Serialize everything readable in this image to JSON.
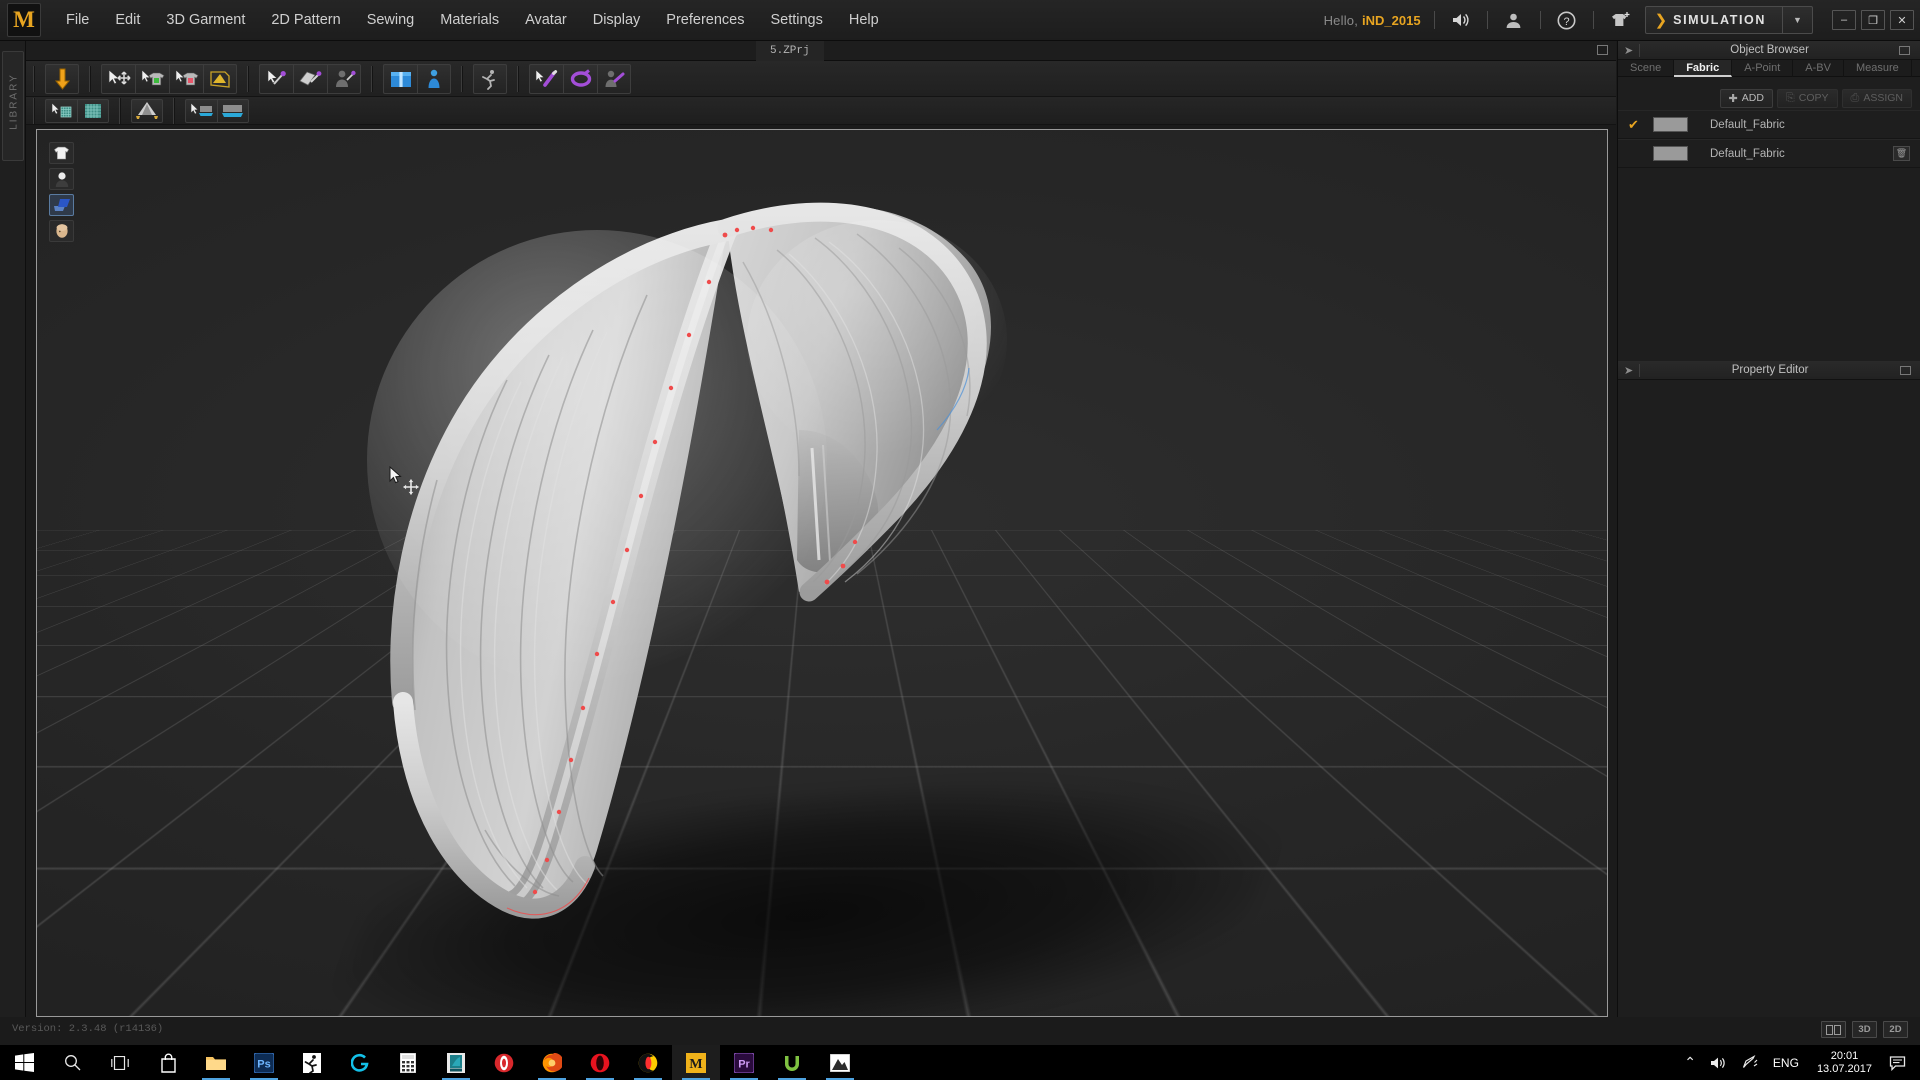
{
  "app": {
    "logo_letter": "M",
    "menu_items": [
      "File",
      "Edit",
      "3D Garment",
      "2D Pattern",
      "Sewing",
      "Materials",
      "Avatar",
      "Display",
      "Preferences",
      "Settings",
      "Help"
    ],
    "greeting": "Hello,",
    "username": "iND_2015",
    "mode_label": "SIMULATION",
    "library_rail_label": "LIBRARY",
    "file_tab": "5.ZPrj",
    "version_text": "Version: 2.3.48    (r14136)"
  },
  "titlebar_icons": [
    {
      "name": "speaker-icon",
      "glyph": "🔊"
    },
    {
      "name": "user-account-icon",
      "glyph": "👤"
    },
    {
      "name": "help-icon",
      "glyph": "?"
    },
    {
      "name": "add-garment-icon",
      "glyph": "👕"
    }
  ],
  "window_controls": [
    {
      "name": "minimize-button",
      "glyph": "–"
    },
    {
      "name": "restore-button",
      "glyph": "❐"
    },
    {
      "name": "close-button",
      "glyph": "✕"
    }
  ],
  "toolbar_row1": [
    {
      "group": "sync",
      "buttons": [
        {
          "name": "simulate-button",
          "icon": "down-arrow-orange"
        }
      ]
    },
    {
      "group": "transform",
      "buttons": [
        {
          "name": "select-move-button",
          "icon": "cursor-move"
        },
        {
          "name": "select-mesh-green-button",
          "icon": "shirt-green"
        },
        {
          "name": "select-mesh-red-button",
          "icon": "shirt-red"
        },
        {
          "name": "fold-arrangement-button",
          "icon": "fold-plane"
        }
      ]
    },
    {
      "group": "pin",
      "buttons": [
        {
          "name": "pin-button",
          "icon": "pin"
        },
        {
          "name": "fold-pin-button",
          "icon": "plane-pin"
        },
        {
          "name": "avatar-pin-button",
          "icon": "avatar-pin"
        }
      ]
    },
    {
      "group": "arrange",
      "buttons": [
        {
          "name": "arrangement-points-button",
          "icon": "box-blue"
        },
        {
          "name": "avatar-arrange-button",
          "icon": "avatar-blue"
        }
      ]
    },
    {
      "group": "animation",
      "buttons": [
        {
          "name": "animation-button",
          "icon": "runner"
        }
      ]
    },
    {
      "group": "tack",
      "buttons": [
        {
          "name": "select-tack-button",
          "icon": "cursor-tack"
        },
        {
          "name": "circular-tack-button",
          "icon": "circle-purple"
        },
        {
          "name": "avatar-tack-button",
          "icon": "avatar-tack"
        }
      ]
    }
  ],
  "toolbar_row2": [
    {
      "group": "texture",
      "buttons": [
        {
          "name": "select-texture-button",
          "icon": "cursor-checker"
        },
        {
          "name": "edit-texture-button",
          "icon": "checker"
        }
      ]
    },
    {
      "group": "gravity",
      "buttons": [
        {
          "name": "gravity-button",
          "icon": "cloth-drop"
        }
      ]
    },
    {
      "group": "layer",
      "buttons": [
        {
          "name": "select-layer-button",
          "icon": "cursor-panel"
        },
        {
          "name": "layer-panel-button",
          "icon": "panel"
        }
      ]
    }
  ],
  "viewport_icons": [
    {
      "name": "show-garment-icon",
      "label": "garment"
    },
    {
      "name": "show-avatar-icon",
      "label": "avatar"
    },
    {
      "name": "show-pattern-icon",
      "label": "pattern",
      "selected": true
    },
    {
      "name": "show-head-icon",
      "label": "head"
    }
  ],
  "object_browser": {
    "title": "Object Browser",
    "tabs": [
      {
        "label": "Scene",
        "active": false
      },
      {
        "label": "Fabric",
        "active": true
      },
      {
        "label": "A-Point",
        "active": false
      },
      {
        "label": "A-BV",
        "active": false
      },
      {
        "label": "Measure",
        "active": false
      }
    ],
    "actions": [
      {
        "label": "ADD",
        "icon": "plus-icon",
        "enabled": true
      },
      {
        "label": "COPY",
        "icon": "copy-icon",
        "enabled": false
      },
      {
        "label": "ASSIGN",
        "icon": "assign-icon",
        "enabled": false
      }
    ],
    "fabrics": [
      {
        "name": "Default_Fabric",
        "checked": true,
        "swatch": "#9a9a9a",
        "deletable": false
      },
      {
        "name": "Default_Fabric",
        "checked": false,
        "swatch": "#9a9a9a",
        "deletable": true
      }
    ]
  },
  "property_editor": {
    "title": "Property Editor"
  },
  "view_buttons": [
    {
      "name": "split-view-button",
      "label": ""
    },
    {
      "name": "view-3d-button",
      "label": "3D"
    },
    {
      "name": "view-2d-button",
      "label": "2D"
    }
  ],
  "taskbar": {
    "items": [
      {
        "name": "start-button",
        "icon": "windows",
        "running": false
      },
      {
        "name": "search-button",
        "icon": "magnifier",
        "running": false
      },
      {
        "name": "task-view-button",
        "icon": "taskview",
        "running": false
      },
      {
        "name": "store-button",
        "icon": "store",
        "running": false
      },
      {
        "name": "file-explorer-button",
        "icon": "folder",
        "running": true
      },
      {
        "name": "photoshop-button",
        "icon": "ps",
        "running": true
      },
      {
        "name": "runner-app-button",
        "icon": "runner",
        "running": false
      },
      {
        "name": "logitech-button",
        "icon": "logi",
        "running": false
      },
      {
        "name": "calculator-button",
        "icon": "calc",
        "running": false
      },
      {
        "name": "teal-app-button",
        "icon": "tealapp",
        "running": true
      },
      {
        "name": "opera-gx-button",
        "icon": "ring",
        "running": false
      },
      {
        "name": "firefox-button",
        "icon": "firefox",
        "running": true
      },
      {
        "name": "opera-button",
        "icon": "opera",
        "running": true
      },
      {
        "name": "yandex-button",
        "icon": "yandex",
        "running": true
      },
      {
        "name": "marvelous-designer-button",
        "icon": "mdlogo",
        "running": true,
        "active": true
      },
      {
        "name": "premiere-button",
        "icon": "pr",
        "running": true
      },
      {
        "name": "utorrent-button",
        "icon": "utorrent",
        "running": true
      },
      {
        "name": "image-viewer-button",
        "icon": "mountain",
        "running": true
      }
    ],
    "tray": {
      "chevron": "⌃",
      "volume_icon": "volume-icon",
      "pen_icon": "pen-icon",
      "language": "ENG",
      "time": "20:01",
      "date": "13.07.2017",
      "notifications_icon": "notification-icon"
    }
  }
}
